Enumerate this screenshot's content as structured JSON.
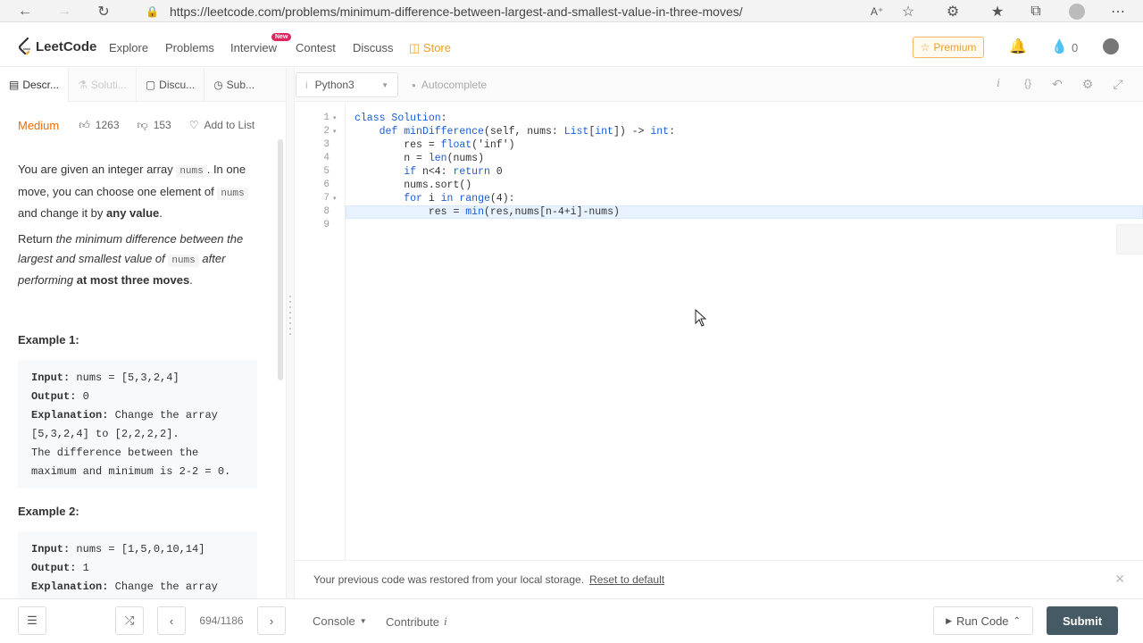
{
  "browser": {
    "url": "https://leetcode.com/problems/minimum-difference-between-largest-and-smallest-value-in-three-moves/"
  },
  "nav": {
    "logo_text": "LeetCode",
    "links": [
      "Explore",
      "Problems",
      "Interview",
      "Contest",
      "Discuss",
      "Store"
    ],
    "new_badge": "New",
    "premium_label": "Premium",
    "points": "0"
  },
  "left_tabs": [
    "Descr...",
    "Soluti...",
    "Discu...",
    "Sub..."
  ],
  "problem": {
    "difficulty": "Medium",
    "likes": "1263",
    "dislikes": "153",
    "add_to_list": "Add to List",
    "p1_a": "You are given an integer array ",
    "p1_code": "nums",
    "p1_b": ". In one move, you can choose one element of ",
    "p1_code2": "nums",
    "p1_c": " and change it by ",
    "p1_bold": "any value",
    "p1_d": ".",
    "p2_a": "Return ",
    "p2_italic": "the minimum difference between the largest and smallest value of ",
    "p2_code": "nums",
    "p2_italic2": " after performing ",
    "p2_bold": "at most three moves",
    "p2_end": ".",
    "example1_title": "Example 1:",
    "example2_title": "Example 2:",
    "example1": {
      "input_label": "Input:",
      "input": " nums = [5,3,2,4]",
      "output_label": "Output:",
      "output": " 0",
      "explanation_label": "Explanation:",
      "explanation_lines": [
        " Change the array",
        "[5,3,2,4] to [2,2,2,2].",
        "The difference between the",
        "maximum and minimum is 2-2 = 0."
      ]
    },
    "example2": {
      "input_label": "Input:",
      "input": " nums = [1,5,0,10,14]",
      "output_label": "Output:",
      "output": " 1",
      "explanation_label": "Explanation:",
      "explanation_first": " Change the array"
    }
  },
  "editor": {
    "language": "Python3",
    "autocomplete": "Autocomplete",
    "lines": [
      "class Solution:",
      "    def minDifference(self, nums: List[int]) -> int:",
      "        res = float('inf')",
      "        n = len(nums)",
      "        if n<4: return 0",
      "        nums.sort()",
      "        for i in range(4):",
      "            res = min(res,nums[n-4+i]-nums)",
      ""
    ],
    "line_numbers": [
      "1",
      "2",
      "3",
      "4",
      "5",
      "6",
      "7",
      "8",
      "9"
    ]
  },
  "notice": {
    "text": "Your previous code was restored from your local storage.",
    "link": "Reset to default"
  },
  "bottom": {
    "page_count": "694/1186",
    "console": "Console",
    "contribute": "Contribute",
    "run_code": "Run Code",
    "submit": "Submit"
  }
}
